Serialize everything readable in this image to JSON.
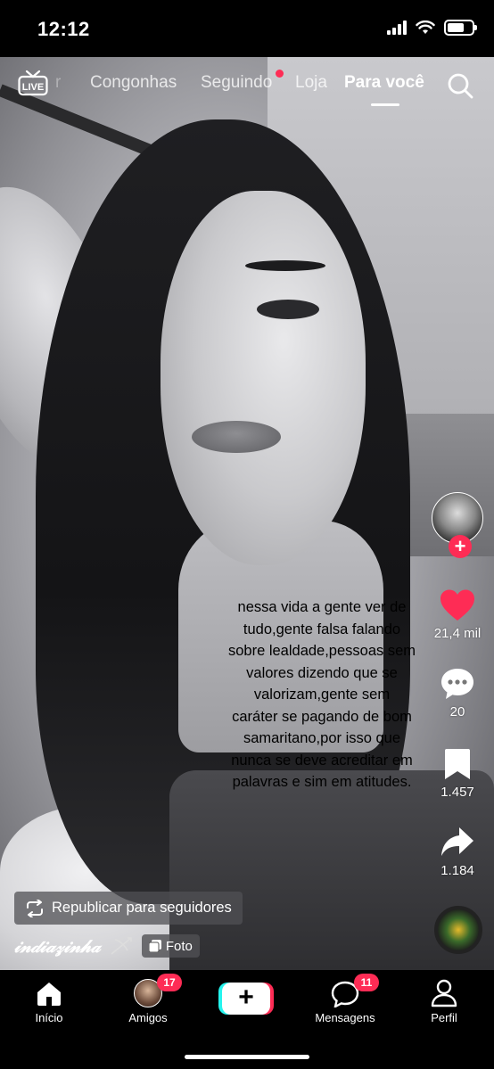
{
  "status_bar": {
    "time": "12:12",
    "battery_level": 0.7
  },
  "top_nav": {
    "live_label": "LIVE",
    "faded_tab": "r",
    "tabs": [
      {
        "label": "Congonhas",
        "active": false
      },
      {
        "label": "Seguindo",
        "active": false,
        "has_dot": true
      },
      {
        "label": "Loja",
        "active": false
      },
      {
        "label": "Para você",
        "active": true
      }
    ],
    "search_icon": "search-icon"
  },
  "video": {
    "caption": "nessa vida a gente ver de\ntudo,gente falsa falando\nsobre lealdade,pessoas sem\nvalores dizendo que se\nvalorizam,gente sem\ncaráter se pagando de bom\nsamaritano,por isso que\nnunca se deve acreditar em\npalavras e sim em atitudes."
  },
  "actions": {
    "likes": "21,4 mil",
    "comments": "20",
    "saves": "1.457",
    "shares": "1.184",
    "like_color": "#fe2c55"
  },
  "post": {
    "repost_label": "Republicar para seguidores",
    "username": "𝒾𝓃𝒹𝒾𝒶𝓏𝒾𝓃𝒽𝒶",
    "photo_badge": "Foto"
  },
  "tab_bar": {
    "home": "Início",
    "friends": "Amigos",
    "friends_badge": "17",
    "messages": "Mensagens",
    "messages_badge": "11",
    "profile": "Perfil"
  },
  "colors": {
    "accent": "#fe2c55",
    "cyan": "#25f4ee"
  }
}
